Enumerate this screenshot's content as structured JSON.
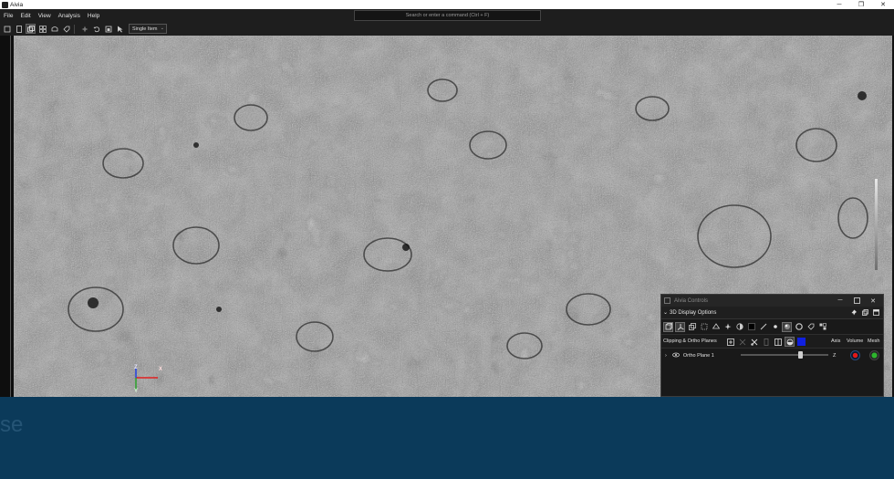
{
  "window": {
    "title": "Aivia",
    "minimize_glyph": "─",
    "maximize_glyph": "❐",
    "close_glyph": "✕"
  },
  "menu": {
    "items": [
      "File",
      "Edit",
      "View",
      "Analysis",
      "Help"
    ]
  },
  "search": {
    "placeholder": "Search or enter a command (Ctrl + F)"
  },
  "toolbar": {
    "view_mode": "Single Item",
    "chevron": "⌄"
  },
  "viewport": {
    "axes": {
      "z": "Z",
      "x": "X",
      "y": "Y"
    },
    "axis_colors": {
      "x": "#e02020",
      "y": "#2aa02a",
      "z": "#2040e0"
    }
  },
  "background_text": "se",
  "controls_panel": {
    "title": "Aivia Controls",
    "section_title": "3D Display Options",
    "section_chevron": "⌄",
    "clipping_label": "Clipping & Ortho Planes",
    "columns": {
      "axis": "Axis",
      "volume": "Volume",
      "mesh": "Mesh"
    },
    "rows": [
      {
        "name": "Ortho Plane 1",
        "axis": "Z",
        "slider_position": 0.68,
        "volume_color": "#e01818",
        "mesh_color": "#2db52d",
        "expand": "›",
        "visibility_glyph": "👁"
      }
    ]
  }
}
